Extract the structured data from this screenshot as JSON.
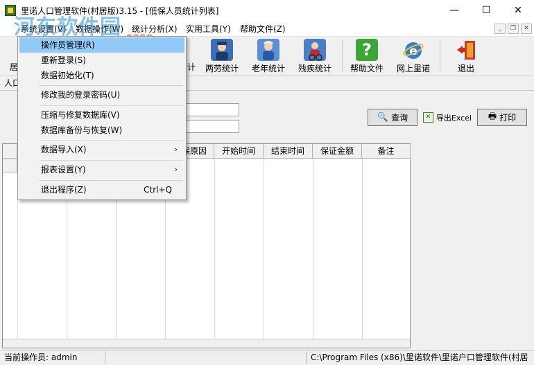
{
  "window": {
    "title": "里诺人口管理软件(村居版)3.15 - [低保人员统计列表]",
    "minimize_glyph": "—",
    "maximize_glyph": "☐",
    "close_glyph": "✕"
  },
  "watermark": {
    "text": "河东软件园",
    "url": "www.pc0359.cn"
  },
  "menubar": {
    "items": [
      "系统设置(V)",
      "数据操作(W)",
      "统计分析(X)",
      "实用工具(Y)",
      "帮助文件(Z)"
    ],
    "mdi_minimize": "_",
    "mdi_restore": "❐",
    "mdi_close": "✕"
  },
  "toolbar": {
    "partial_left": "居",
    "partial_mid": "计",
    "buttons": [
      {
        "label": "两劳统计",
        "icon": "police-officer-icon",
        "color": "#3b6fb6"
      },
      {
        "label": "老年统计",
        "icon": "elderly-person-icon",
        "color": "#5b8fd4"
      },
      {
        "label": "残疾统计",
        "icon": "disabled-person-icon",
        "color": "#4a7fc8"
      },
      {
        "label": "帮助文件",
        "icon": "help-question-icon",
        "color": "#3aa635"
      },
      {
        "label": "网上里诺",
        "icon": "web-browser-icon",
        "color": "#2f7fd8"
      },
      {
        "label": "退出",
        "icon": "exit-door-icon",
        "color": "#c73a2a"
      }
    ]
  },
  "tabstrip": {
    "partial_tab": "人口"
  },
  "query": {
    "query_label": "查询",
    "export_label": "导出Excel",
    "print_label": "打印"
  },
  "grid": {
    "columns": [
      "",
      "",
      "",
      "",
      "低保原因",
      "开始时间",
      "结束时间",
      "保证金额",
      "备注"
    ]
  },
  "statusbar": {
    "operator": "当前操作员: admin",
    "path": "C:\\Program Files (x86)\\里诺软件\\里诺户口管理软件(村居"
  },
  "dropdown": {
    "items": [
      {
        "label": "操作员管理(R)",
        "shortcut": "",
        "submenu": false,
        "highlighted": true
      },
      {
        "label": "重新登录(S)",
        "shortcut": "",
        "submenu": false,
        "highlighted": false
      },
      {
        "label": "数据初始化(T)",
        "shortcut": "",
        "submenu": false,
        "highlighted": false
      },
      {
        "label": "修改我的登录密码(U)",
        "shortcut": "",
        "submenu": false,
        "highlighted": false
      },
      {
        "label": "压缩与修复数据库(V)",
        "shortcut": "",
        "submenu": false,
        "highlighted": false
      },
      {
        "label": "数据库备份与恢复(W)",
        "shortcut": "",
        "submenu": false,
        "highlighted": false
      },
      {
        "label": "数据导入(X)",
        "shortcut": "",
        "submenu": true,
        "highlighted": false
      },
      {
        "label": "报表设置(Y)",
        "shortcut": "",
        "submenu": true,
        "highlighted": false
      },
      {
        "label": "退出程序(Z)",
        "shortcut": "Ctrl+Q",
        "submenu": false,
        "highlighted": false
      }
    ],
    "submenu_arrow": "›"
  }
}
